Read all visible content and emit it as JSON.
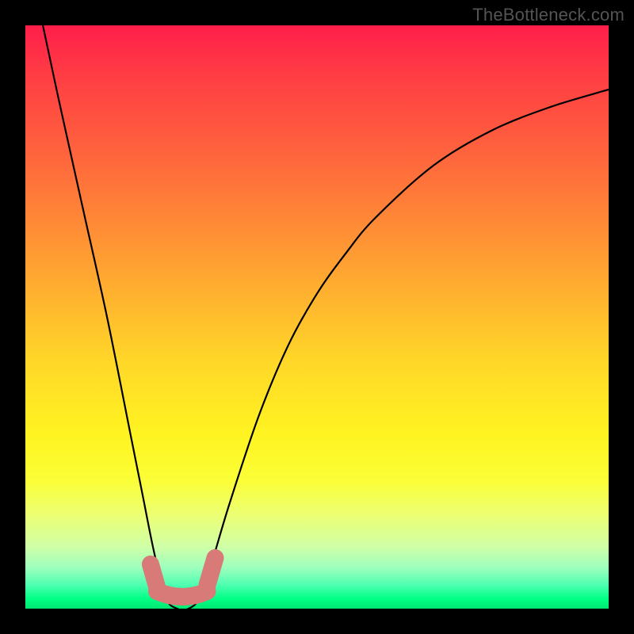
{
  "watermark": "TheBottleneck.com",
  "colors": {
    "background": "#000000",
    "gradient_top": "#ff1e4b",
    "gradient_bottom": "#00e874",
    "curve": "#000000",
    "blob": "#d77a78"
  },
  "chart_data": {
    "type": "line",
    "title": "",
    "xlabel": "",
    "ylabel": "",
    "xlim": [
      0,
      100
    ],
    "ylim": [
      0,
      100
    ],
    "grid": false,
    "legend": false,
    "notes": "Bottleneck-style curve. Y≈100 means high bottleneck (red), Y≈0 means ideal (green). Minimum plateau between x≈24 and x≈30 at y≈0.",
    "series": [
      {
        "name": "bottleneck",
        "x": [
          3,
          6,
          10,
          14,
          18,
          20,
          22,
          24,
          26,
          28,
          30,
          32,
          35,
          40,
          45,
          50,
          55,
          60,
          70,
          80,
          90,
          100
        ],
        "y": [
          100,
          86,
          68,
          50,
          30,
          20,
          10,
          2,
          0,
          0,
          2,
          8,
          18,
          33,
          45,
          54,
          61,
          67,
          76,
          82,
          86,
          89
        ]
      }
    ],
    "highlight": {
      "x_range": [
        22,
        32
      ],
      "y": 0,
      "meaning": "near-zero bottleneck region (salmon markers)"
    }
  }
}
